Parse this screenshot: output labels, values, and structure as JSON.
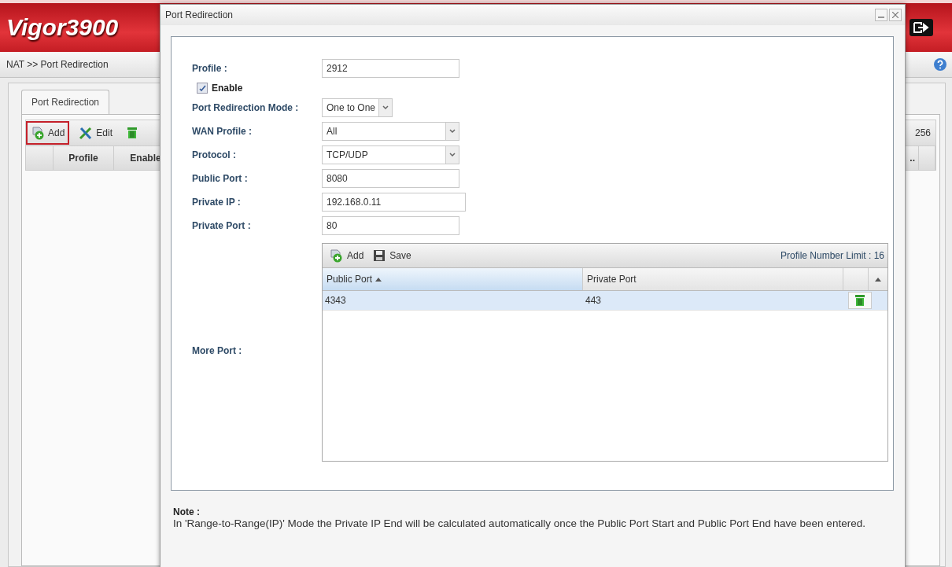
{
  "app": {
    "title": "Vigor3900",
    "breadcrumb": "NAT >> Port Redirection",
    "tab": {
      "label": "Port Redirection",
      "selected": true
    },
    "toolbar": [
      {
        "kind": "add",
        "label": "Add",
        "highlighted": true
      },
      {
        "kind": "edit",
        "label": "Edit",
        "highlighted": false
      },
      {
        "kind": "delete",
        "highlighted": false
      }
    ],
    "count": "256",
    "columns": [
      "Profile",
      "Enable"
    ],
    "cut_column": ".."
  },
  "dialog": {
    "title": "Port Redirection",
    "fields": [
      {
        "kind": "text",
        "label": "Profile :",
        "value": "2912"
      },
      {
        "kind": "checkbox",
        "label": "Enable",
        "checked": true
      },
      {
        "kind": "select",
        "label": "Port Redirection Mode :",
        "value": "One to One"
      },
      {
        "kind": "select",
        "label": "WAN Profile :",
        "value": "All"
      },
      {
        "kind": "select",
        "label": "Protocol :",
        "value": "TCP/UDP"
      },
      {
        "kind": "text",
        "label": "Public Port :",
        "value": "8080"
      },
      {
        "kind": "text",
        "label": "Private IP :",
        "value": "192.168.0.11"
      },
      {
        "kind": "text",
        "label": "Private Port :",
        "value": "80"
      }
    ],
    "more_port": {
      "label": "More Port :",
      "toolbar": [
        {
          "kind": "add",
          "label": "Add"
        },
        {
          "kind": "save",
          "label": "Save"
        }
      ],
      "limit": "Profile Number Limit :  16",
      "columns": [
        {
          "label": "Public Port",
          "sorted": true
        },
        {
          "label": "Private Port",
          "sorted": false
        }
      ],
      "rows": [
        {
          "public_port": "4343",
          "private_port": "443",
          "selected": true
        }
      ]
    },
    "note": {
      "title": "Note :",
      "text": "In 'Range-to-Range(IP)' Mode the Private IP End will be calculated automatically once the Public Port Start and Public Port End have been entered."
    }
  }
}
